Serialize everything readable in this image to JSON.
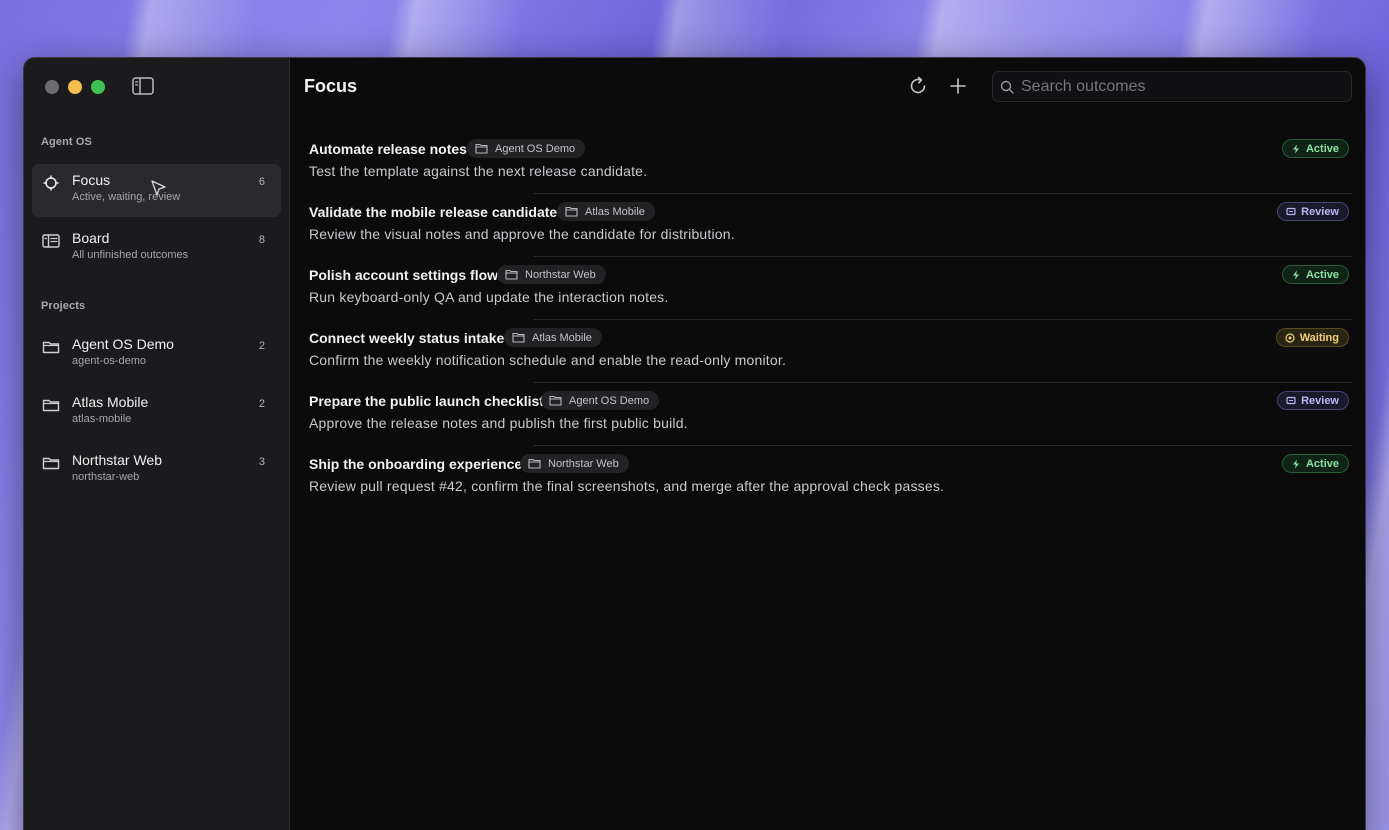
{
  "sidebar": {
    "section_agent_os": "Agent OS",
    "views": [
      {
        "title": "Focus",
        "subtitle": "Active, waiting, review",
        "count": "6",
        "icon": "crosshair-icon"
      },
      {
        "title": "Board",
        "subtitle": "All unfinished outcomes",
        "count": "8",
        "icon": "board-icon"
      }
    ],
    "section_projects": "Projects",
    "projects": [
      {
        "title": "Agent OS Demo",
        "subtitle": "agent-os-demo",
        "count": "2",
        "icon": "folder-icon"
      },
      {
        "title": "Atlas Mobile",
        "subtitle": "atlas-mobile",
        "count": "2",
        "icon": "folder-icon"
      },
      {
        "title": "Northstar Web",
        "subtitle": "northstar-web",
        "count": "3",
        "icon": "folder-icon"
      }
    ]
  },
  "header": {
    "title": "Focus",
    "search_placeholder": "Search outcomes"
  },
  "outcomes": [
    {
      "title": "Automate release notes",
      "project": "Agent OS Demo",
      "description": "Test the template against the next release candidate.",
      "status": "Active"
    },
    {
      "title": "Validate the mobile release candidate",
      "project": "Atlas Mobile",
      "description": "Review the visual notes and approve the candidate for distribution.",
      "status": "Review"
    },
    {
      "title": "Polish account settings flow",
      "project": "Northstar Web",
      "description": "Run keyboard-only QA and update the interaction notes.",
      "status": "Active"
    },
    {
      "title": "Connect weekly status intake",
      "project": "Atlas Mobile",
      "description": "Confirm the weekly notification schedule and enable the read-only monitor.",
      "status": "Waiting"
    },
    {
      "title": "Prepare the public launch checklist",
      "project": "Agent OS Demo",
      "description": "Approve the release notes and publish the first public build.",
      "status": "Review"
    },
    {
      "title": "Ship the onboarding experience",
      "project": "Northstar Web",
      "description": "Review pull request #42, confirm the final screenshots, and merge after the approval check passes.",
      "status": "Active"
    }
  ],
  "colors": {
    "active": "#8fe0a2",
    "review": "#b8b8f2",
    "waiting": "#efcf7a"
  }
}
